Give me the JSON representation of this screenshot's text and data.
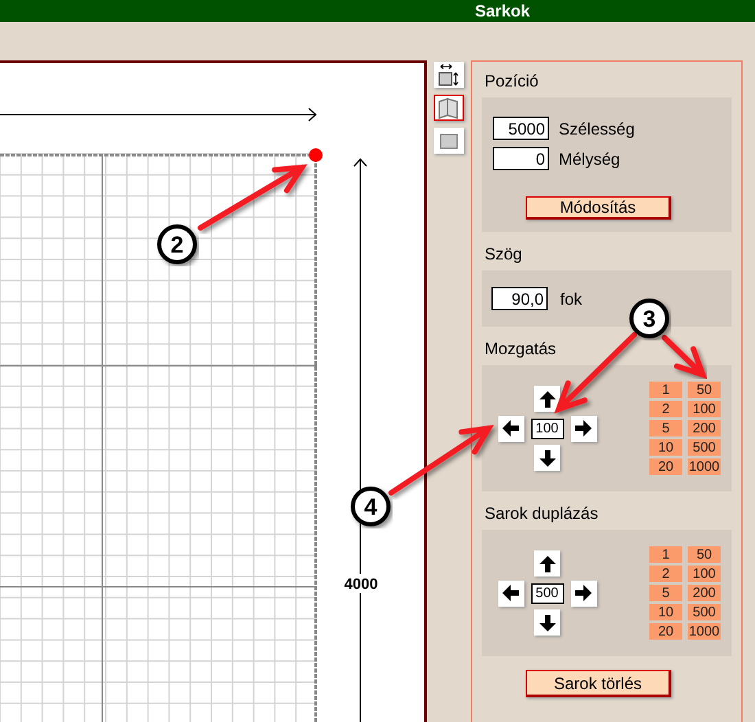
{
  "window": {
    "title": "Sarkok"
  },
  "tools": [
    {
      "kind": "resize",
      "selected": false
    },
    {
      "kind": "corner",
      "selected": true
    },
    {
      "kind": "plain",
      "selected": false
    }
  ],
  "canvas": {
    "dimension_label": "4000"
  },
  "position": {
    "title": "Pozíció",
    "width": {
      "label": "Szélesség",
      "value": "5000"
    },
    "depth": {
      "label": "Mélység",
      "value": "0"
    },
    "button": "Módosítás"
  },
  "angle": {
    "title": "Szög",
    "value": "90,0",
    "unit": "fok"
  },
  "move": {
    "title": "Mozgatás",
    "value": "100",
    "steps": [
      [
        "1",
        "50"
      ],
      [
        "2",
        "100"
      ],
      [
        "5",
        "200"
      ],
      [
        "10",
        "500"
      ],
      [
        "20",
        "1000"
      ]
    ]
  },
  "duplicate": {
    "title": "Sarok duplázás",
    "value": "500",
    "steps": [
      [
        "1",
        "50"
      ],
      [
        "2",
        "100"
      ],
      [
        "5",
        "200"
      ],
      [
        "10",
        "500"
      ],
      [
        "20",
        "1000"
      ]
    ]
  },
  "delete_button": "Sarok törlés",
  "annotations": [
    {
      "label": "2"
    },
    {
      "label": "3"
    },
    {
      "label": "4"
    }
  ]
}
